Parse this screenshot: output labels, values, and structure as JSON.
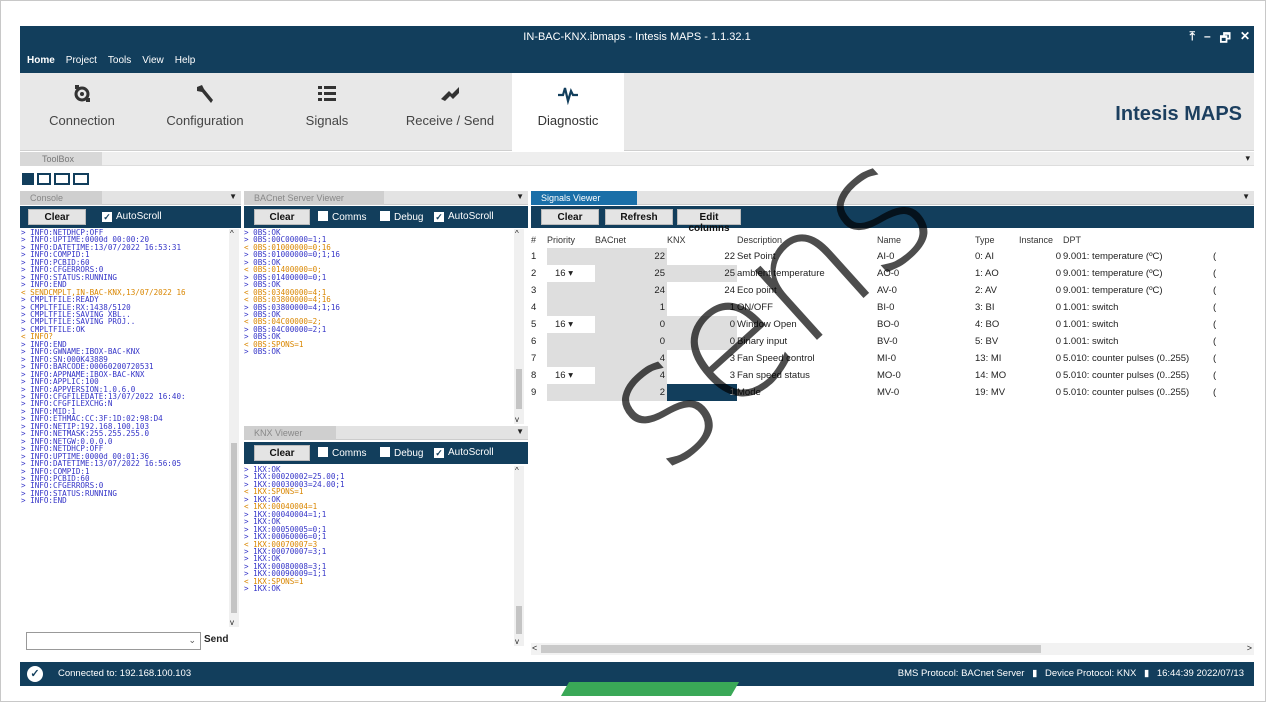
{
  "window": {
    "title": "IN-BAC-KNX.ibmaps - Intesis MAPS - 1.1.32.1",
    "controls": [
      "⤒",
      "–",
      "🗗",
      "✕"
    ]
  },
  "menu": [
    "Home",
    "Project",
    "Tools",
    "View",
    "Help"
  ],
  "ribbon": {
    "tabs": [
      {
        "label": "Connection",
        "icon": "connection-icon"
      },
      {
        "label": "Configuration",
        "icon": "wrench-icon"
      },
      {
        "label": "Signals",
        "icon": "list-icon"
      },
      {
        "label": "Receive / Send",
        "icon": "transfer-icon"
      },
      {
        "label": "Diagnostic",
        "icon": "pulse-icon"
      }
    ],
    "brand": "Intesis MAPS"
  },
  "toolbox": {
    "label": "ToolBox",
    "arrow": "▾"
  },
  "console": {
    "header": "Console",
    "clear": "Clear",
    "autoscroll": "AutoScroll",
    "send": "Send",
    "lines": [
      {
        "t": "> INFO:NETDHCP:OFF",
        "o": false
      },
      {
        "t": "> INFO:UPTIME:0000d 00:00:20",
        "o": false
      },
      {
        "t": "> INFO:DATETIME:13/07/2022 16:53:31",
        "o": false
      },
      {
        "t": "> INFO:COMPID:1",
        "o": false
      },
      {
        "t": "> INFO:PCBID:60",
        "o": false
      },
      {
        "t": "> INFO:CFGERRORS:0",
        "o": false
      },
      {
        "t": "> INFO:STATUS:RUNNING",
        "o": false
      },
      {
        "t": "> INFO:END",
        "o": false
      },
      {
        "t": "< SENDCMPLT,IN-BAC-KNX,13/07/2022 16",
        "o": true
      },
      {
        "t": "> CMPLTFILE:READY",
        "o": false
      },
      {
        "t": "> CMPLTFILE:RX:1438/5120",
        "o": false
      },
      {
        "t": "> CMPLTFILE:SAVING XBL..",
        "o": false
      },
      {
        "t": "> CMPLTFILE:SAVING PROJ..",
        "o": false
      },
      {
        "t": "> CMPLTFILE:OK",
        "o": false
      },
      {
        "t": "< INFO?",
        "o": true
      },
      {
        "t": "> INFO:END",
        "o": false
      },
      {
        "t": "> INFO:GWNAME:IBOX-BAC-KNX",
        "o": false
      },
      {
        "t": "> INFO:SN:000K43889",
        "o": false
      },
      {
        "t": "> INFO:BARCODE:00060200720531",
        "o": false
      },
      {
        "t": "> INFO:APPNAME:IBOX-BAC-KNX",
        "o": false
      },
      {
        "t": "> INFO:APPLIC:100",
        "o": false
      },
      {
        "t": "> INFO:APPVERSION:1.0.6.0",
        "o": false
      },
      {
        "t": "> INFO:CFGFILEDATE:13/07/2022 16:40:",
        "o": false
      },
      {
        "t": "> INFO:CFGFILEXCHG:N",
        "o": false
      },
      {
        "t": "> INFO:MID:1",
        "o": false
      },
      {
        "t": "> INFO:ETHMAC:CC:3F:1D:02:98:D4",
        "o": false
      },
      {
        "t": "> INFO:NETIP:192.168.100.103",
        "o": false
      },
      {
        "t": "> INFO:NETMASK:255.255.255.0",
        "o": false
      },
      {
        "t": "> INFO:NETGW:0.0.0.0",
        "o": false
      },
      {
        "t": "> INFO:NETDHCP:OFF",
        "o": false
      },
      {
        "t": "> INFO:UPTIME:0000d 00:01:36",
        "o": false
      },
      {
        "t": "> INFO:DATETIME:13/07/2022 16:56:05",
        "o": false
      },
      {
        "t": "> INFO:COMPID:1",
        "o": false
      },
      {
        "t": "> INFO:PCBID:60",
        "o": false
      },
      {
        "t": "> INFO:CFGERRORS:0",
        "o": false
      },
      {
        "t": "> INFO:STATUS:RUNNING",
        "o": false
      },
      {
        "t": "> INFO:END",
        "o": false
      }
    ]
  },
  "bacnet": {
    "header": "BACnet Server Viewer",
    "clear": "Clear",
    "comms": "Comms",
    "debug": "Debug",
    "autoscroll": "AutoScroll",
    "lines": [
      {
        "t": "> 0BS:OK",
        "o": false
      },
      {
        "t": "> 0BS:00C00000=1;1",
        "o": false
      },
      {
        "t": "< 0BS:01000000=0;16",
        "o": true
      },
      {
        "t": "> 0BS:01000000=0;1;16",
        "o": false
      },
      {
        "t": "> 0BS:OK",
        "o": false
      },
      {
        "t": "< 0BS:01400000=0;",
        "o": true
      },
      {
        "t": "> 0BS:01400000=0;1",
        "o": false
      },
      {
        "t": "> 0BS:OK",
        "o": false
      },
      {
        "t": "< 0BS:03400000=4;1",
        "o": true
      },
      {
        "t": "< 0BS:03800000=4;16",
        "o": true
      },
      {
        "t": "> 0BS:03800000=4;1;16",
        "o": false
      },
      {
        "t": "> 0BS:OK",
        "o": false
      },
      {
        "t": "< 0BS:04C00000=2;",
        "o": true
      },
      {
        "t": "> 0BS:04C00000=2;1",
        "o": false
      },
      {
        "t": "> 0BS:OK",
        "o": false
      },
      {
        "t": "< 0BS:SPONS=1",
        "o": true
      },
      {
        "t": "> 0BS:OK",
        "o": false
      }
    ]
  },
  "knx": {
    "header": "KNX Viewer",
    "clear": "Clear",
    "comms": "Comms",
    "debug": "Debug",
    "autoscroll": "AutoScroll",
    "lines": [
      {
        "t": "> 1KX:OK",
        "o": false
      },
      {
        "t": "> 1KX:00020002=25.00;1",
        "o": false
      },
      {
        "t": "> 1KX:00030003=24.00;1",
        "o": false
      },
      {
        "t": "< 1KX:SPONS=1",
        "o": true
      },
      {
        "t": "> 1KX:OK",
        "o": false
      },
      {
        "t": "< 1KX:00040004=1",
        "o": true
      },
      {
        "t": "> 1KX:00040004=1;1",
        "o": false
      },
      {
        "t": "> 1KX:OK",
        "o": false
      },
      {
        "t": "> 1KX:00050005=0;1",
        "o": false
      },
      {
        "t": "> 1KX:00060006=0;1",
        "o": false
      },
      {
        "t": "< 1KX:00070007=3",
        "o": true
      },
      {
        "t": "> 1KX:00070007=3;1",
        "o": false
      },
      {
        "t": "> 1KX:OK",
        "o": false
      },
      {
        "t": "> 1KX:00080008=3;1",
        "o": false
      },
      {
        "t": "> 1KX:00090009=1;1",
        "o": false
      },
      {
        "t": "< 1KX:SPONS=1",
        "o": true
      },
      {
        "t": "> 1KX:OK",
        "o": false
      }
    ]
  },
  "signals": {
    "header": "Signals Viewer",
    "clear": "Clear",
    "refresh": "Refresh",
    "edit": "Edit columns",
    "columns": [
      "#",
      "Priority",
      "BACnet",
      "KNX",
      "Description",
      "Name",
      "Type",
      "Instance",
      "DPT",
      ""
    ],
    "rows": [
      {
        "n": "1",
        "p": "",
        "b": "22",
        "k": "22",
        "d": "Set Point",
        "name": "AI-0",
        "type": "0: AI",
        "inst": "0",
        "dpt": "9.001: temperature (ºC)",
        "c": "("
      },
      {
        "n": "2",
        "p": "16",
        "b": "25",
        "k": "25",
        "d": "ambient temperature",
        "name": "AO-0",
        "type": "1: AO",
        "inst": "0",
        "dpt": "9.001: temperature (ºC)",
        "c": "("
      },
      {
        "n": "3",
        "p": "",
        "b": "24",
        "k": "24",
        "d": "Eco point",
        "name": "AV-0",
        "type": "2: AV",
        "inst": "0",
        "dpt": "9.001: temperature (ºC)",
        "c": "("
      },
      {
        "n": "4",
        "p": "",
        "b": "1",
        "k": "1",
        "d": "ON/OFF",
        "name": "BI-0",
        "type": "3: BI",
        "inst": "0",
        "dpt": "1.001: switch",
        "c": "("
      },
      {
        "n": "5",
        "p": "16",
        "b": "0",
        "k": "0",
        "d": "Window Open",
        "name": "BO-0",
        "type": "4: BO",
        "inst": "0",
        "dpt": "1.001: switch",
        "c": "("
      },
      {
        "n": "6",
        "p": "",
        "b": "0",
        "k": "0",
        "d": "Binary input",
        "name": "BV-0",
        "type": "5: BV",
        "inst": "0",
        "dpt": "1.001: switch",
        "c": "("
      },
      {
        "n": "7",
        "p": "",
        "b": "4",
        "k": "3",
        "d": "Fan Speed control",
        "name": "MI-0",
        "type": "13: MI",
        "inst": "0",
        "dpt": "5.010: counter pulses (0..255)",
        "c": "("
      },
      {
        "n": "8",
        "p": "16",
        "b": "4",
        "k": "3",
        "d": "Fan speed status",
        "name": "MO-0",
        "type": "14: MO",
        "inst": "0",
        "dpt": "5.010: counter pulses (0..255)",
        "c": "("
      },
      {
        "n": "9",
        "p": "",
        "b": "2",
        "k": "1",
        "d": "Mode",
        "name": "MV-0",
        "type": "19: MV",
        "inst": "0",
        "dpt": "5.010: counter pulses (0..255)",
        "c": "("
      }
    ]
  },
  "status": {
    "connected": "Connected to: 192.168.100.103",
    "bms": "BMS Protocol: BACnet Server",
    "device": "Device Protocol: KNX",
    "time": "16:44:39 2022/07/13"
  },
  "watermark": "sens"
}
